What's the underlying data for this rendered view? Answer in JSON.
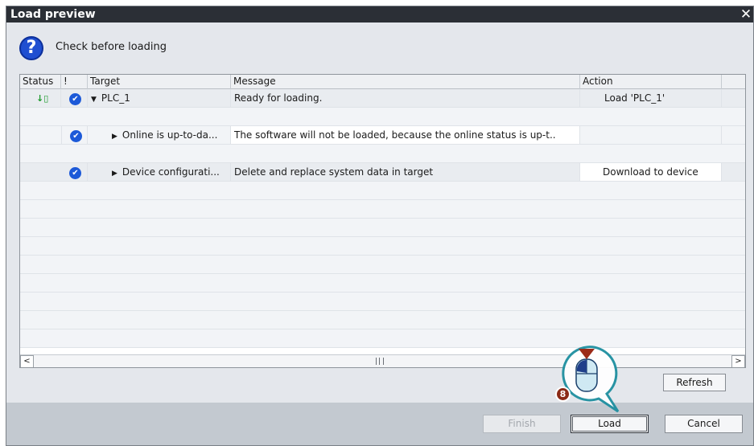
{
  "dialog": {
    "title": "Load preview",
    "close_glyph": "✕",
    "header_text": "Check before loading",
    "help_glyph": "?"
  },
  "columns": [
    "Status",
    "!",
    "Target",
    "Message",
    "Action"
  ],
  "rows": [
    {
      "status_icon": "status-loading-icon",
      "status_glyph": "↓▯",
      "check": true,
      "expand": "▼",
      "target": "PLC_1",
      "message": "Ready for loading.",
      "action": "Load 'PLC_1'"
    },
    {
      "check": true,
      "expand": "▶",
      "target": "Online is up-to-da...",
      "message": "The software will not be loaded, because the online status is up-t..",
      "action": ""
    },
    {
      "check": true,
      "expand": "▶",
      "target": "Device configurati...",
      "message": "Delete and replace system data in target",
      "action": "Download to device"
    }
  ],
  "scrollbar": {
    "left_glyph": "<",
    "right_glyph": ">"
  },
  "buttons": {
    "refresh": "Refresh",
    "finish": "Finish",
    "load": "Load",
    "cancel": "Cancel"
  },
  "callout": {
    "step_number": "8"
  },
  "colors": {
    "titlebar": "#2b2f36",
    "check_blue": "#1c59d8",
    "help_blue": "#1f4fd1",
    "callout_teal": "#1e8fa0",
    "badge_red": "#8b2a16"
  }
}
